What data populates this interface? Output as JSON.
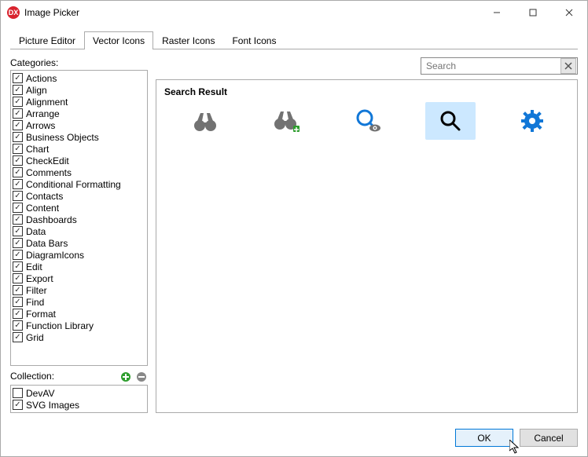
{
  "window": {
    "title": "Image Picker"
  },
  "tabs": [
    "Picture Editor",
    "Vector Icons",
    "Raster Icons",
    "Font Icons"
  ],
  "active_tab": 1,
  "labels": {
    "categories": "Categories:",
    "collection": "Collection:",
    "search_placeholder": "Search",
    "results_title": "Search Result"
  },
  "categories": [
    "Actions",
    "Align",
    "Alignment",
    "Arrange",
    "Arrows",
    "Business Objects",
    "Chart",
    "CheckEdit",
    "Comments",
    "Conditional Formatting",
    "Contacts",
    "Content",
    "Dashboards",
    "Data",
    "Data Bars",
    "DiagramIcons",
    "Edit",
    "Export",
    "Filter",
    "Find",
    "Format",
    "Function Library",
    "Grid"
  ],
  "collections": [
    {
      "name": "DevAV",
      "checked": false
    },
    {
      "name": "SVG Images",
      "checked": true
    }
  ],
  "buttons": {
    "ok": "OK",
    "cancel": "Cancel"
  },
  "result_icons": [
    "binoculars-icon",
    "binoculars-add-icon",
    "magnifier-eye-icon",
    "magnifier-icon",
    "gear-icon"
  ],
  "selected_result": 3
}
